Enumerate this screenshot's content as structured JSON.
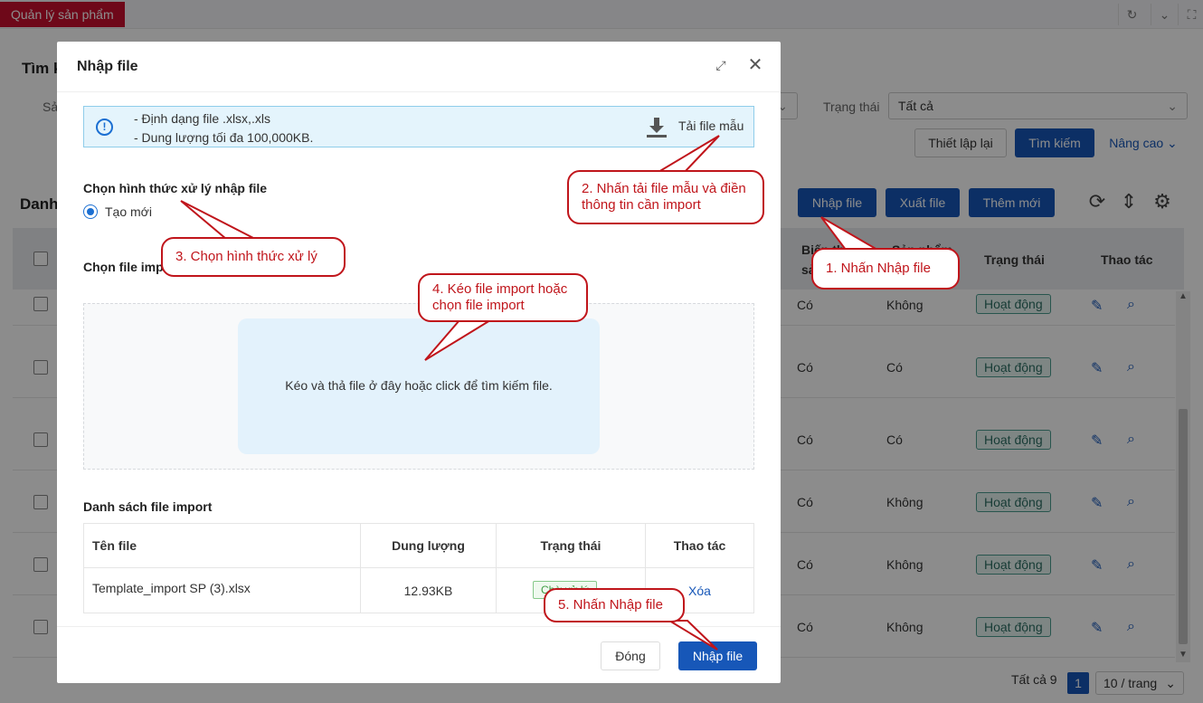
{
  "topbar": {
    "active_tab": "Quản lý sản phẩm",
    "refresh_icon": "refresh-icon",
    "chevron_icon": "chevron-down-icon",
    "fullscreen_icon": "fullscreen-icon"
  },
  "background": {
    "search_title": "Tìm k",
    "product_label": "Sả",
    "status_label": "Trạng thái",
    "status_value": "Tất cả",
    "reset_button": "Thiết lập lại",
    "search_button": "Tìm kiếm",
    "advanced_button": "Nâng cao",
    "list_title": "Danh",
    "import_button": "Nhập file",
    "export_button": "Xuất file",
    "add_button": "Thêm mới",
    "columns": {
      "variant": "Biến th",
      "variant_2": "sả",
      "product": "Sản phẩm",
      "status": "Trạng thái",
      "actions": "Thao tác"
    },
    "rows": [
      {
        "variant": "Có",
        "product": "Không",
        "status": "Hoạt động"
      },
      {
        "variant": "Có",
        "product": "Có",
        "status": "Hoạt động"
      },
      {
        "variant": "Có",
        "product": "Có",
        "status": "Hoạt động"
      },
      {
        "variant": "Có",
        "product": "Không",
        "status": "Hoạt động"
      },
      {
        "variant": "Có",
        "product": "Không",
        "status": "Hoạt động"
      },
      {
        "variant": "Có",
        "product": "Không",
        "status": "Hoạt động"
      }
    ],
    "total_text": "Tất cả 9",
    "current_page": "1",
    "page_size": "10 / trang"
  },
  "modal": {
    "title": "Nhập file",
    "info_line1": "- Định dạng file .xlsx,.xls",
    "info_line2": "- Dung lượng tối đa 100,000KB.",
    "download_template": "Tải file mẫu",
    "processing_title": "Chọn hình thức xử lý nhập file",
    "processing_option": "Tạo mới",
    "choose_file_title": "Chọn file imp",
    "dropzone_text": "Kéo và thả file ở đây hoặc click để tìm kiếm file.",
    "list_title": "Danh sách file import",
    "table": {
      "headers": [
        "Tên file",
        "Dung lượng",
        "Trạng thái",
        "Thao tác"
      ],
      "rows": [
        {
          "name": "Template_import SP (3).xlsx",
          "size": "12.93KB",
          "status": "Chờ xử lý",
          "action": "Xóa"
        }
      ]
    },
    "close_button": "Đóng",
    "import_button": "Nhập file"
  },
  "callouts": [
    {
      "text": "2. Nhấn tải file mẫu và điền thông tin cần import"
    },
    {
      "text": "3. Chọn hình thức xử lý"
    },
    {
      "text": "1. Nhấn Nhập file"
    },
    {
      "text": "4. Kéo file import hoặc chọn file import"
    },
    {
      "text": "5. Nhấn Nhập file"
    }
  ],
  "colors": {
    "brand_red": "#c8102e",
    "primary_blue": "#1757b8",
    "callout_red": "#c0151b",
    "info_bg": "#e4f4fc",
    "status_green": "#2c6e63"
  }
}
